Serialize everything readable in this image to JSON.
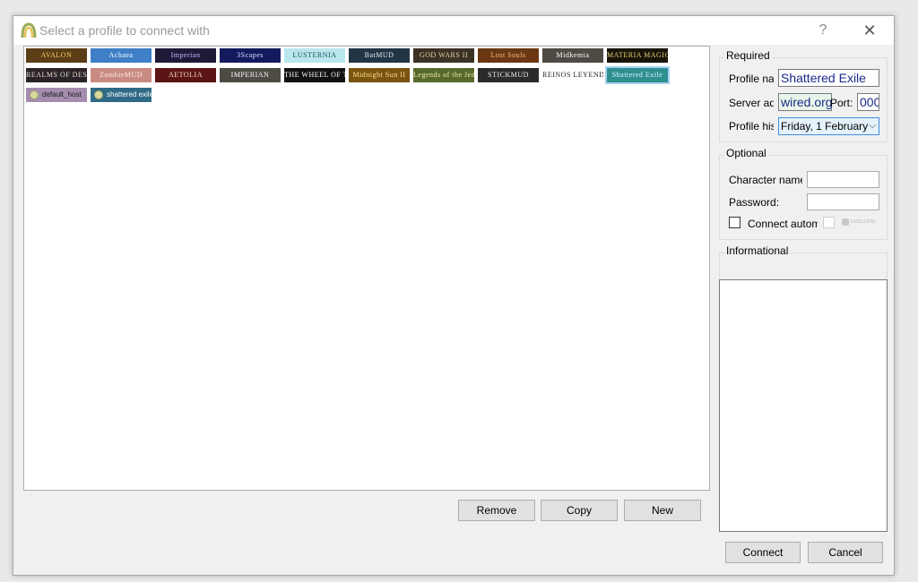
{
  "window": {
    "title": "Select a profile to connect with",
    "help_glyph": "?",
    "close_glyph": "✕"
  },
  "profiles": [
    {
      "label": "AVALON",
      "bg": "#5b3d16",
      "fg": "#f6d16a"
    },
    {
      "label": "Achaea",
      "bg": "#3e7fc7",
      "fg": "#ffffff"
    },
    {
      "label": "Imperian",
      "bg": "#1d1a38",
      "fg": "#c9b7ff"
    },
    {
      "label": "3Scapes",
      "bg": "#141a5e",
      "fg": "#dbe3ff"
    },
    {
      "label": "LUSTERNIA",
      "bg": "#b9e7ee",
      "fg": "#1c4c5f"
    },
    {
      "label": "BatMUD",
      "bg": "#223545",
      "fg": "#e8eef7"
    },
    {
      "label": "GOD WARS II",
      "bg": "#3b3226",
      "fg": "#e6d6a0"
    },
    {
      "label": "Lost Souls",
      "bg": "#6a3812",
      "fg": "#f3c08a"
    },
    {
      "label": "Midkemia",
      "bg": "#504a44",
      "fg": "#ffffff"
    },
    {
      "label": "MATERIA MAGICA",
      "bg": "#181408",
      "fg": "#e6cf7a"
    },
    {
      "label": "REALMS OF DESPAIR",
      "bg": "#2a2328",
      "fg": "#e0d7c6"
    },
    {
      "label": "ZombieMUD",
      "bg": "#c98a82",
      "fg": "#fff0e8"
    },
    {
      "label": "AETOLIA",
      "bg": "#5c1515",
      "fg": "#f3dcc2"
    },
    {
      "label": "IMPERIAN",
      "bg": "#4e4a44",
      "fg": "#ffffff"
    },
    {
      "label": "THE WHEEL OF TIME MUD",
      "bg": "#111111",
      "fg": "#ffffff"
    },
    {
      "label": "Midnight Sun II",
      "bg": "#7a5511",
      "fg": "#ffe28c"
    },
    {
      "label": "Legends of the Jedi",
      "bg": "#576a2c",
      "fg": "#f4e8b0"
    },
    {
      "label": "STICKMUD",
      "bg": "#2b2b2b",
      "fg": "#ededed"
    },
    {
      "label": "REINOS LEYENDA",
      "bg": "#ffffff",
      "fg": "#222222"
    },
    {
      "label": "Shattered Exile",
      "bg": "#2f8f8f",
      "fg": "#e0f8ff"
    },
    {
      "label": "default_host",
      "bg": "#a58db0",
      "fg": "#1a1a1a"
    },
    {
      "label": "shattered exile",
      "bg": "#2f6a86",
      "fg": "#ffffff"
    }
  ],
  "buttons": {
    "remove": "Remove",
    "copy": "Copy",
    "new": "New",
    "connect": "Connect",
    "cancel": "Cancel"
  },
  "required": {
    "title": "Required",
    "profile_name_label": "Profile name:",
    "profile_name_value": "Shattered Exile",
    "server_address_label": "Server address:",
    "server_address_value": "wired.org",
    "port_label": "Port:",
    "port_value": "000",
    "history_label": "Profile history:",
    "history_value": "Friday, 1 February"
  },
  "optional": {
    "title": "Optional",
    "character_label": "Character name:",
    "character_value": "",
    "password_label": "Password:",
    "password_value": "",
    "autologin_label": "Connect automatically",
    "discord_label": "DISCORD"
  },
  "informational": {
    "title": "Informational"
  }
}
